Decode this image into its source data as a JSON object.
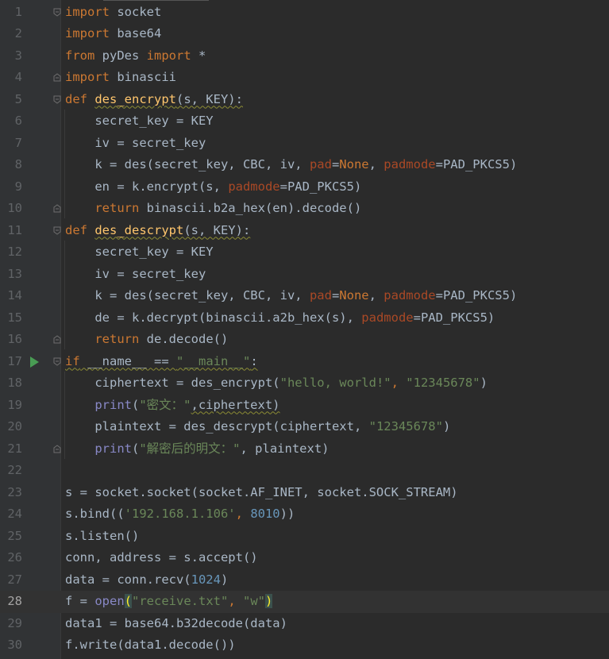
{
  "editor": {
    "current_line": 28,
    "run_marker_line": 17,
    "line_numbers": [
      "1",
      "2",
      "3",
      "4",
      "5",
      "6",
      "7",
      "8",
      "9",
      "10",
      "11",
      "12",
      "13",
      "14",
      "15",
      "16",
      "17",
      "18",
      "19",
      "20",
      "21",
      "22",
      "23",
      "24",
      "25",
      "26",
      "27",
      "28",
      "29",
      "30"
    ],
    "code": {
      "l1_kw": "import",
      "l1_rest": " socket",
      "l2_kw": "import",
      "l2_rest": " base64",
      "l3_kw1": "from",
      "l3_mid": " pyDes ",
      "l3_kw2": "import",
      "l3_rest": " *",
      "l4_kw": "import",
      "l4_rest": " binascii",
      "l5_kw": "def ",
      "l5_fn": "des_encrypt",
      "l5_sig": "(s, KEY):",
      "l6": "    secret_key = KEY",
      "l7": "    iv = secret_key",
      "l8_a": "    k = des(secret_key, CBC, iv, ",
      "l8_p1": "pad",
      "l8_eq": "=",
      "l8_none": "None",
      "l8_c": ", ",
      "l8_p2": "padmode",
      "l8_d": "=PAD_PKCS5)",
      "l9_a": "    en = k.encrypt(s, ",
      "l9_p": "padmode",
      "l9_b": "=PAD_PKCS5)",
      "l10_ind": "    ",
      "l10_kw": "return",
      "l10_rest": " binascii.b2a_hex(en).decode()",
      "l11_kw": "def ",
      "l11_fn": "des_descrypt",
      "l11_sig": "(s, KEY):",
      "l12": "    secret_key = KEY",
      "l13": "    iv = secret_key",
      "l14_a": "    k = des(secret_key, CBC, iv, ",
      "l14_p1": "pad",
      "l14_eq": "=",
      "l14_none": "None",
      "l14_c": ", ",
      "l14_p2": "padmode",
      "l14_d": "=PAD_PKCS5)",
      "l15_a": "    de = k.decrypt(binascii.a2b_hex(s), ",
      "l15_p": "padmode",
      "l15_b": "=PAD_PKCS5)",
      "l16_ind": "    ",
      "l16_kw": "return",
      "l16_rest": " de.decode()",
      "l17_kw": "if",
      "l17_mid": " __name__ == ",
      "l17_str": "\"__main__\"",
      "l17_end": ":",
      "l18_a": "    ciphertext = des_encrypt(",
      "l18_s1": "\"hello, world!\"",
      "l18_c": ", ",
      "l18_s2": "\"12345678\"",
      "l18_e": ")",
      "l19_ind": "    ",
      "l19_bi": "print",
      "l19_op": "(",
      "l19_s": "\"密文：\"",
      "l19_rest": ",ciphertext)",
      "l20_a": "    plaintext = des_descrypt(ciphertext, ",
      "l20_s": "\"12345678\"",
      "l20_e": ")",
      "l21_ind": "    ",
      "l21_bi": "print",
      "l21_op": "(",
      "l21_s": "\"解密后的明文：\"",
      "l21_rest": ", plaintext)",
      "l22": "",
      "l23": "s = socket.socket(socket.AF_INET, socket.SOCK_STREAM)",
      "l24_a": "s.bind((",
      "l24_s": "'192.168.1.106'",
      "l24_c": ", ",
      "l24_n": "8010",
      "l24_e": "))",
      "l25": "s.listen()",
      "l26": "conn, address = s.accept()",
      "l27_a": "data = conn.recv(",
      "l27_n": "1024",
      "l27_e": ")",
      "l28_a": "f = ",
      "l28_bi": "open",
      "l28_op": "(",
      "l28_s1": "\"receive.txt\"",
      "l28_c": ", ",
      "l28_s2": "\"w\"",
      "l28_cp": ")",
      "l29": "data1 = base64.b32decode(data)",
      "l30": "f.write(data1.decode())"
    }
  }
}
